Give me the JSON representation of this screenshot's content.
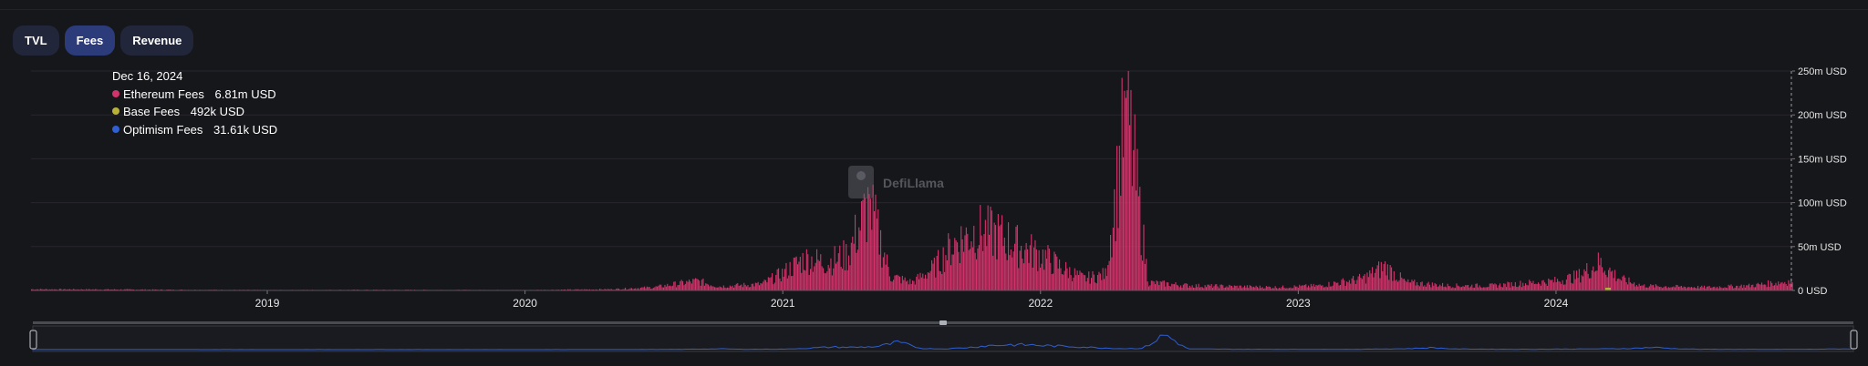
{
  "tabs": [
    {
      "label": "TVL",
      "active": false
    },
    {
      "label": "Fees",
      "active": true
    },
    {
      "label": "Revenue",
      "active": false
    }
  ],
  "tooltip": {
    "date": "Dec 16, 2024",
    "entries": [
      {
        "name": "Ethereum Fees",
        "value": "6.81m USD",
        "color": "#d3336b"
      },
      {
        "name": "Base Fees",
        "value": "492k USD",
        "color": "#b9b03a"
      },
      {
        "name": "Optimism Fees",
        "value": "31.61k USD",
        "color": "#2f5fd1"
      }
    ]
  },
  "watermark": "DefiLlama",
  "chart_data": {
    "type": "bar",
    "ylim": [
      0,
      250
    ],
    "y_unit": "m USD",
    "yticks": [
      "250m USD",
      "200m USD",
      "150m USD",
      "100m USD",
      "50m USD",
      "0 USD"
    ],
    "xticks": [
      "2019",
      "2020",
      "2021",
      "2022",
      "2023",
      "2024"
    ],
    "x_range": [
      "2018-02",
      "2024-12"
    ],
    "series": [
      {
        "name": "Ethereum Fees",
        "color": "#d3336b",
        "points": [
          [
            "2018-02",
            1.5
          ],
          [
            "2018-06",
            1.2
          ],
          [
            "2018-09",
            0.8
          ],
          [
            "2019-01",
            0.5
          ],
          [
            "2019-06",
            0.7
          ],
          [
            "2020-01",
            0.5
          ],
          [
            "2020-05",
            1.5
          ],
          [
            "2020-07",
            4
          ],
          [
            "2020-09",
            12
          ],
          [
            "2020-10",
            5
          ],
          [
            "2020-12",
            8
          ],
          [
            "2021-01",
            22
          ],
          [
            "2021-02",
            40
          ],
          [
            "2021-03",
            35
          ],
          [
            "2021-04",
            45
          ],
          [
            "2021-05",
            110
          ],
          [
            "2021-06",
            18
          ],
          [
            "2021-07",
            10
          ],
          [
            "2021-08",
            28
          ],
          [
            "2021-09",
            60
          ],
          [
            "2021-10",
            75
          ],
          [
            "2021-11",
            70
          ],
          [
            "2021-12",
            55
          ],
          [
            "2022-01",
            45
          ],
          [
            "2022-02",
            28
          ],
          [
            "2022-03",
            15
          ],
          [
            "2022-04",
            20
          ],
          [
            "2022-05",
            230
          ],
          [
            "2022-06",
            10
          ],
          [
            "2022-08",
            6
          ],
          [
            "2022-10",
            5
          ],
          [
            "2022-12",
            4
          ],
          [
            "2023-02",
            6
          ],
          [
            "2023-04",
            15
          ],
          [
            "2023-05",
            30
          ],
          [
            "2023-06",
            10
          ],
          [
            "2023-08",
            6
          ],
          [
            "2023-10",
            6
          ],
          [
            "2023-12",
            10
          ],
          [
            "2024-01",
            12
          ],
          [
            "2024-02",
            18
          ],
          [
            "2024-03",
            35
          ],
          [
            "2024-04",
            14
          ],
          [
            "2024-05",
            6
          ],
          [
            "2024-06",
            5
          ],
          [
            "2024-08",
            4
          ],
          [
            "2024-10",
            6
          ],
          [
            "2024-11",
            9
          ],
          [
            "2024-12",
            12
          ]
        ]
      },
      {
        "name": "Base Fees",
        "color": "#b9b03a",
        "last_value": 0.492
      },
      {
        "name": "Optimism Fees",
        "color": "#2f5fd1",
        "last_value": 0.03161
      }
    ],
    "grid": true,
    "legend": "top-left tooltip"
  }
}
